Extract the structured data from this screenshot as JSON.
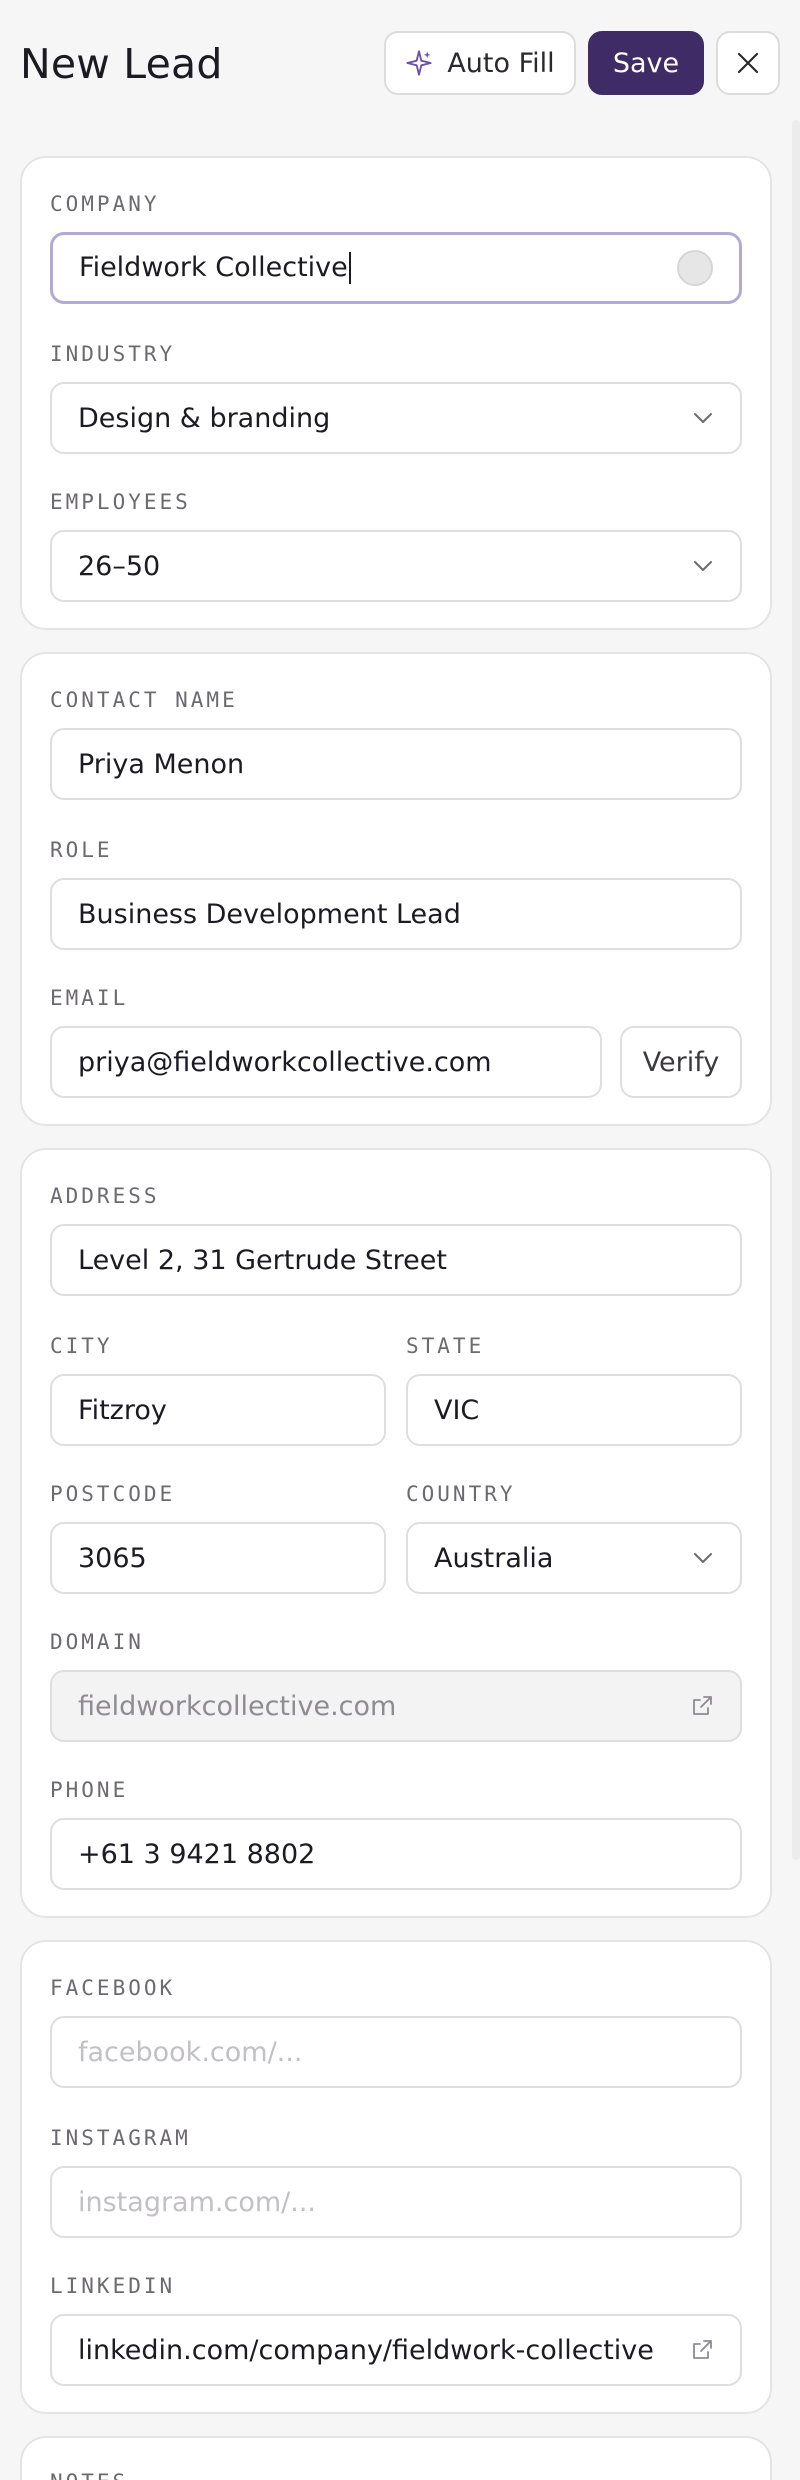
{
  "header": {
    "title": "New Lead",
    "autofill_label": "Auto Fill",
    "save_label": "Save"
  },
  "company_card": {
    "company_label": "COMPANY",
    "company_value": "Fieldwork Collective",
    "industry_label": "INDUSTRY",
    "industry_value": "Design & branding",
    "employees_label": "EMPLOYEES",
    "employees_value": "26–50"
  },
  "contact_card": {
    "contact_label": "CONTACT NAME",
    "contact_value": "Priya Menon",
    "role_label": "ROLE",
    "role_value": "Business Development Lead",
    "email_label": "EMAIL",
    "email_value": "priya@fieldworkcollective.com",
    "verify_label": "Verify"
  },
  "address_card": {
    "address_label": "ADDRESS",
    "address_value": "Level 2, 31 Gertrude Street",
    "city_label": "CITY",
    "city_value": "Fitzroy",
    "state_label": "STATE",
    "state_value": "VIC",
    "postcode_label": "POSTCODE",
    "postcode_value": "3065",
    "country_label": "COUNTRY",
    "country_value": "Australia",
    "domain_label": "DOMAIN",
    "domain_value": "fieldworkcollective.com",
    "phone_label": "PHONE",
    "phone_value": "+61 3 9421 8802"
  },
  "social_card": {
    "facebook_label": "FACEBOOK",
    "facebook_placeholder": "facebook.com/...",
    "instagram_label": "INSTAGRAM",
    "instagram_placeholder": "instagram.com/...",
    "linkedin_label": "LINKEDIN",
    "linkedin_value": "linkedin.com/company/fieldwork-collective"
  },
  "notes_card": {
    "notes_label": "NOTES"
  },
  "colors": {
    "accent": "#3f2b66",
    "focus_border": "#b3a9d3",
    "sparkle": "#6b4fb0"
  },
  "icons": {
    "autofill": "sparkle-icon",
    "close": "close-icon",
    "select": "chevron-down-icon",
    "external": "external-link-icon",
    "clear": "clear-input-icon"
  }
}
